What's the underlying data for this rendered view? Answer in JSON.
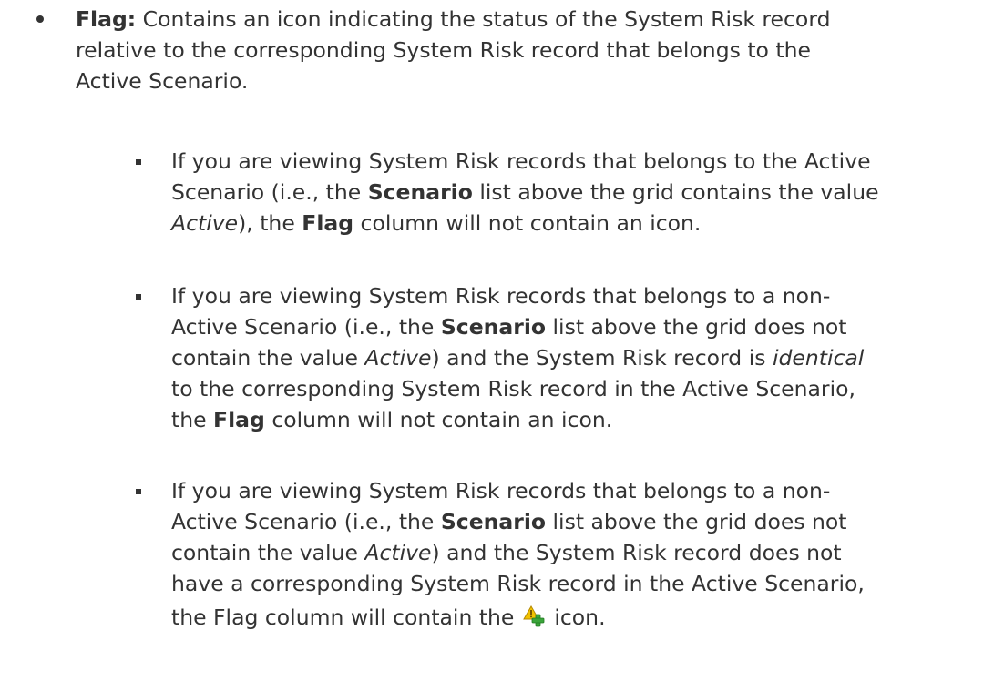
{
  "bullet": {
    "term": "Flag:",
    "lines": [
      " Contains an icon indicating the status of the System Risk record",
      "relative to the corresponding System Risk record that belongs to the",
      "Active Scenario."
    ]
  },
  "sub1": {
    "l1": "If you are viewing System Risk records that belongs to the Active",
    "l2_a": "Scenario (i.e., the ",
    "l2_b": "Scenario",
    "l2_c": " list above the grid contains the value",
    "l3_a": "Active",
    "l3_b": "), the ",
    "l3_c": "Flag",
    "l3_d": " column will not contain an icon."
  },
  "sub2": {
    "l1": "If you are viewing System Risk records that belongs to a non-",
    "l2_a": "Active Scenario (i.e., the ",
    "l2_b": "Scenario",
    "l2_c": " list above the grid does not",
    "l3_a": "contain the value ",
    "l3_b": "Active",
    "l3_c": ") and the System Risk record is ",
    "l3_d": "identical",
    "l4": "to the corresponding System Risk record in the Active Scenario,",
    "l5_a": "the ",
    "l5_b": "Flag",
    "l5_c": " column will not contain an icon."
  },
  "sub3": {
    "l1": "If you are viewing System Risk records that belongs to a non-",
    "l2_a": "Active Scenario (i.e., the ",
    "l2_b": "Scenario",
    "l2_c": " list above the grid does not",
    "l3_a": "contain the value ",
    "l3_b": "Active",
    "l3_c": ") and the System Risk record does not",
    "l4": "have a corresponding System Risk record in the Active Scenario,",
    "l5_a": "the Flag column will contain the ",
    "l5_b": " icon."
  },
  "icons": {
    "flag_icon": "warning-add-icon"
  },
  "colors": {
    "text": "#333333",
    "warning_yellow": "#f2c200",
    "add_green": "#3aa53a"
  }
}
